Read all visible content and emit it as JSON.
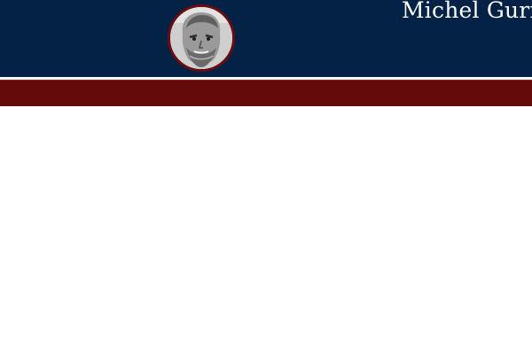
{
  "header": {
    "site_title": "Michel Gurfinkiel",
    "background_color": "#042245",
    "avatar_icon": "portrait-photo-icon"
  },
  "nav": {
    "background_color": "#640a0a",
    "items": []
  },
  "colors": {
    "accent": "#6b0d0f",
    "rule": "#ffffff"
  }
}
